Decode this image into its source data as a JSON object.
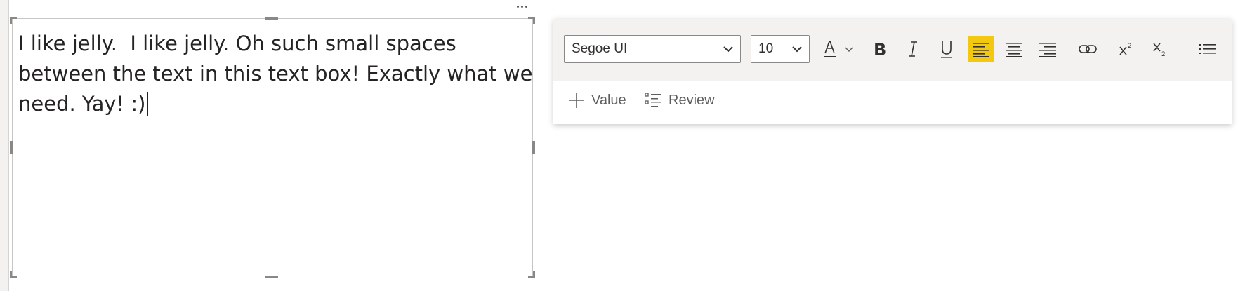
{
  "textbox": {
    "lines": [
      "I like jelly.  I like jelly. Oh such small spaces",
      "between the text in this text box! Exactly what we",
      "need. Yay! :)"
    ]
  },
  "toolbar": {
    "font_family": "Segoe UI",
    "font_size": "10",
    "value_label": "Value",
    "review_label": "Review",
    "active_alignment": "align-left",
    "highlight_color": "#f2c811"
  },
  "icons": [
    "more-options-icon",
    "chevron-down-icon",
    "font-color-icon",
    "bold-icon",
    "italic-icon",
    "underline-icon",
    "align-left-icon",
    "align-center-icon",
    "align-right-icon",
    "link-icon",
    "superscript-icon",
    "subscript-icon",
    "list-icon",
    "plus-icon",
    "review-list-icon"
  ]
}
